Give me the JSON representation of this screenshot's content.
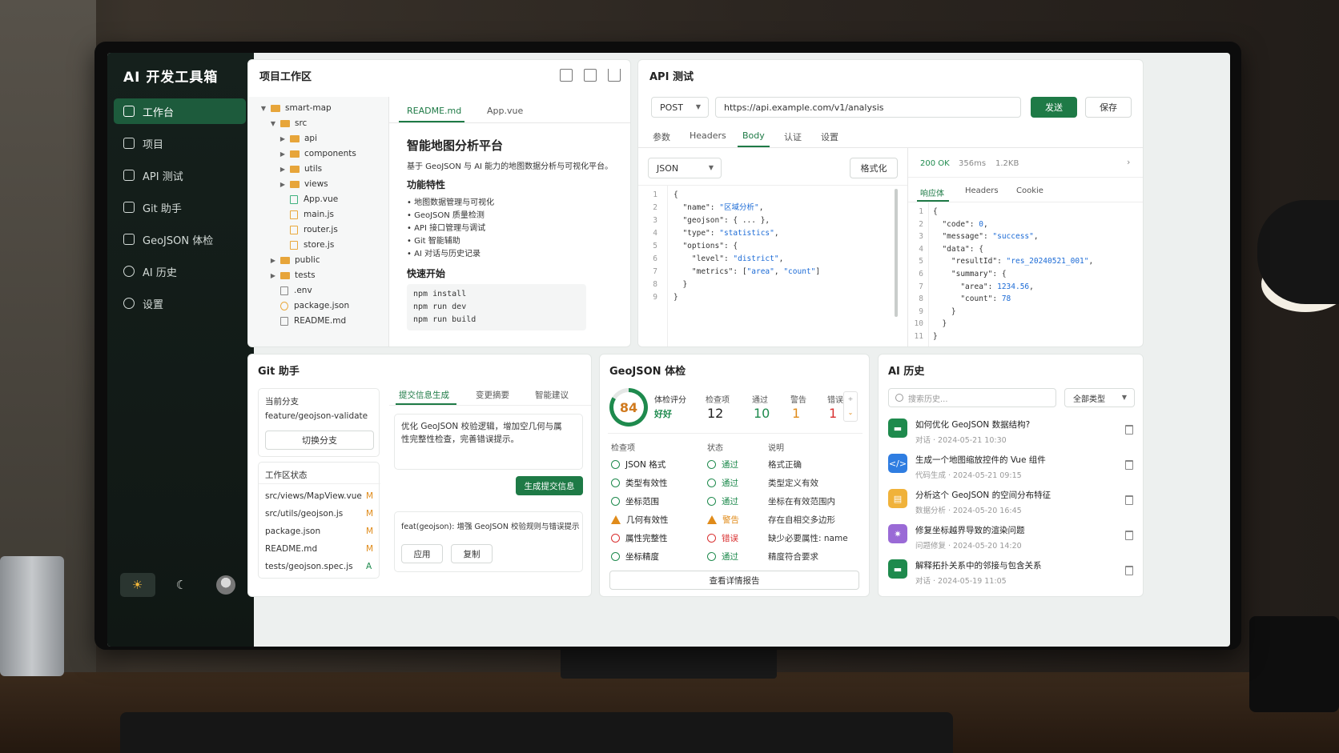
{
  "app": {
    "title": "AI 开发工具箱"
  },
  "nav": [
    {
      "label": "工作台",
      "icon": "workspace-icon"
    },
    {
      "label": "项目",
      "icon": "folder-icon"
    },
    {
      "label": "API 测试",
      "icon": "api-icon"
    },
    {
      "label": "Git 助手",
      "icon": "git-icon"
    },
    {
      "label": "GeoJSON 体检",
      "icon": "geojson-icon"
    },
    {
      "label": "AI 历史",
      "icon": "clock-icon"
    },
    {
      "label": "设置",
      "icon": "gear-icon"
    }
  ],
  "project": {
    "title": "项目工作区",
    "tree": [
      {
        "name": "smart-map",
        "type": "folder",
        "depth": 0,
        "open": true
      },
      {
        "name": "src",
        "type": "folder",
        "depth": 1,
        "open": true
      },
      {
        "name": "api",
        "type": "folder",
        "depth": 2,
        "open": false
      },
      {
        "name": "components",
        "type": "folder",
        "depth": 2,
        "open": false
      },
      {
        "name": "utils",
        "type": "folder",
        "depth": 2,
        "open": false
      },
      {
        "name": "views",
        "type": "folder",
        "depth": 2,
        "open": false
      },
      {
        "name": "App.vue",
        "type": "vue",
        "depth": 2
      },
      {
        "name": "main.js",
        "type": "js",
        "depth": 2
      },
      {
        "name": "router.js",
        "type": "js",
        "depth": 2
      },
      {
        "name": "store.js",
        "type": "js",
        "depth": 2
      },
      {
        "name": "public",
        "type": "folder",
        "depth": 1,
        "open": false
      },
      {
        "name": "tests",
        "type": "folder",
        "depth": 1,
        "open": false
      },
      {
        "name": ".env",
        "type": "file",
        "depth": 1
      },
      {
        "name": "package.json",
        "type": "json",
        "depth": 1
      },
      {
        "name": "README.md",
        "type": "file",
        "depth": 1
      }
    ],
    "tabs": [
      "README.md",
      "App.vue"
    ],
    "readme": {
      "h1": "智能地图分析平台",
      "intro": "基于 GeoJSON 与 AI 能力的地图数据分析与可视化平台。",
      "features_title": "功能特性",
      "features": [
        "地图数据管理与可视化",
        "GeoJSON 质量检测",
        "API 接口管理与调试",
        "Git 智能辅助",
        "AI 对话与历史记录"
      ],
      "quick_title": "快速开始",
      "commands": [
        "npm install",
        "npm run dev",
        "npm run build"
      ]
    }
  },
  "api": {
    "title": "API 测试",
    "method": "POST",
    "url": "https://api.example.com/v1/analysis",
    "send": "发送",
    "save": "保存",
    "tabs": [
      "参数",
      "Headers",
      "Body",
      "认证",
      "设置"
    ],
    "body_type": "JSON",
    "format": "格式化",
    "body_lines": [
      "{",
      "  \"name\": \"区域分析\",",
      "  \"geojson\": { ... },",
      "  \"type\": \"statistics\",",
      "  \"options\": {",
      "    \"level\": \"district\",",
      "    \"metrics\": [\"area\", \"count\"]",
      "  }",
      "}"
    ],
    "status": "200 OK",
    "time": "356ms",
    "size": "1.2KB",
    "resp_tabs": [
      "响应体",
      "Headers",
      "Cookie"
    ],
    "resp_lines": [
      "{",
      "  \"code\": 0,",
      "  \"message\": \"success\",",
      "  \"data\": {",
      "    \"resultId\": \"res_20240521_001\",",
      "    \"summary\": {",
      "      \"area\": 1234.56,",
      "      \"count\": 78",
      "    }",
      "  }",
      "}"
    ]
  },
  "git": {
    "title": "Git 助手",
    "branch_label": "当前分支",
    "branch": "feature/geojson-validate",
    "switch": "切换分支",
    "status_label": "工作区状态",
    "changes": [
      {
        "file": "src/views/MapView.vue",
        "flag": "M"
      },
      {
        "file": "src/utils/geojson.js",
        "flag": "M"
      },
      {
        "file": "package.json",
        "flag": "M"
      },
      {
        "file": "README.md",
        "flag": "M"
      },
      {
        "file": "tests/geojson.spec.js",
        "flag": "A"
      }
    ],
    "tabs": [
      "提交信息生成",
      "变更摘要",
      "智能建议"
    ],
    "prompt": "优化 GeoJSON 校验逻辑，增加空几何与属性完整性检查，完善错误提示。",
    "generate": "生成提交信息",
    "result": "feat(geojson): 增强 GeoJSON 校验规则与错误提示",
    "apply": "应用",
    "copy": "复制"
  },
  "geo": {
    "title": "GeoJSON 体检",
    "score": "84",
    "score_label": "体检评分",
    "score_grade": "好好",
    "stats": [
      {
        "label": "检查项",
        "value": "12",
        "color": "#222222"
      },
      {
        "label": "通过",
        "value": "10",
        "color": "#1e8a4d"
      },
      {
        "label": "警告",
        "value": "1",
        "color": "#e08b1a"
      },
      {
        "label": "错误",
        "value": "1",
        "color": "#d93030"
      }
    ],
    "headers": [
      "检查项",
      "状态",
      "说明"
    ],
    "rows": [
      {
        "item": "JSON 格式",
        "status": "通过",
        "kind": "ok",
        "note": "格式正确"
      },
      {
        "item": "类型有效性",
        "status": "通过",
        "kind": "ok",
        "note": "类型定义有效"
      },
      {
        "item": "坐标范围",
        "status": "通过",
        "kind": "ok",
        "note": "坐标在有效范围内"
      },
      {
        "item": "几何有效性",
        "status": "警告",
        "kind": "warn",
        "note": "存在自相交多边形"
      },
      {
        "item": "属性完整性",
        "status": "错误",
        "kind": "err",
        "note": "缺少必要属性: name"
      },
      {
        "item": "坐标精度",
        "status": "通过",
        "kind": "ok",
        "note": "精度符合要求"
      }
    ],
    "report": "查看详情报告"
  },
  "history": {
    "title": "AI 历史",
    "search_placeholder": "搜索历史...",
    "filter": "全部类型",
    "items": [
      {
        "title": "如何优化 GeoJSON 数据结构?",
        "meta": "对话 · 2024-05-21 10:30",
        "color": "#1e8a4d",
        "icon": "chat-icon"
      },
      {
        "title": "生成一个地图缩放控件的 Vue 组件",
        "meta": "代码生成 · 2024-05-21 09:15",
        "color": "#2f7de1",
        "icon": "code-icon"
      },
      {
        "title": "分析这个 GeoJSON 的空间分布特征",
        "meta": "数据分析 · 2024-05-20 16:45",
        "color": "#f0b23a",
        "icon": "analysis-icon"
      },
      {
        "title": "修复坐标越界导致的渲染问题",
        "meta": "问题修复 · 2024-05-20 14:20",
        "color": "#9a6ad6",
        "icon": "bug-icon"
      },
      {
        "title": "解释拓扑关系中的邻接与包含关系",
        "meta": "对话 · 2024-05-19 11:05",
        "color": "#1e8a4d",
        "icon": "chat-icon"
      }
    ]
  }
}
